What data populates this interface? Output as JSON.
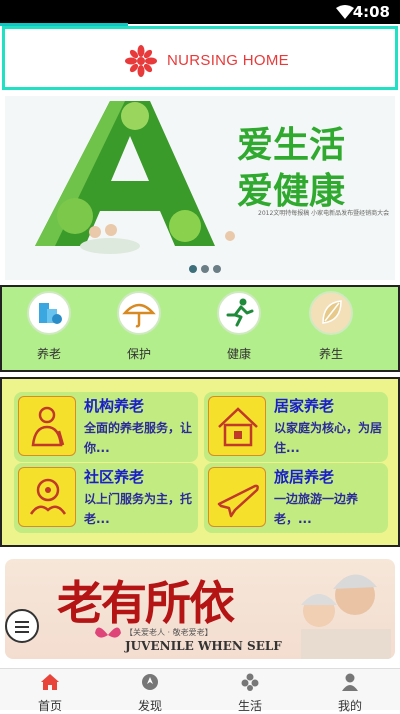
{
  "status_bar": {
    "time": "4:08"
  },
  "header": {
    "title": "NURSING HOME"
  },
  "banner": {
    "slogan_line1": "爱生活",
    "slogan_line2": "爱健康",
    "caption": "2012文明特每报稿   小家电新品发布暨经销商大会"
  },
  "categories": [
    {
      "label": "养老",
      "icon": "building-icon"
    },
    {
      "label": "保护",
      "icon": "umbrella-icon"
    },
    {
      "label": "健康",
      "icon": "running-icon"
    },
    {
      "label": "养生",
      "icon": "leaf-icon"
    }
  ],
  "services": [
    {
      "name": "机构养老",
      "desc": "全面的养老服务，让你...",
      "icon": "elder-icon"
    },
    {
      "name": "居家养老",
      "desc": "以家庭为核心，为居住...",
      "icon": "home-icon"
    },
    {
      "name": "社区养老",
      "desc": "以上门服务为主，托老...",
      "icon": "community-icon"
    },
    {
      "name": "旅居养老",
      "desc": "一边旅游一边养老，...",
      "icon": "plane-icon"
    }
  ],
  "poster": {
    "headline": "老有所依",
    "line1": "【关爱老人 · 敬老爱老】",
    "line2": "JUVENILE WHEN SELF"
  },
  "tabs": [
    {
      "label": "首页",
      "icon": "home-tab-icon",
      "active": true
    },
    {
      "label": "发现",
      "icon": "discover-icon",
      "active": false
    },
    {
      "label": "生活",
      "icon": "life-icon",
      "active": false
    },
    {
      "label": "我的",
      "icon": "user-icon",
      "active": false
    }
  ],
  "colors": {
    "accent": "#22e0c4",
    "brand_red": "#e83a3a",
    "category_bg": "#b3ee8c",
    "service_bg": "#eef48c",
    "service_title": "#1a20c8"
  }
}
